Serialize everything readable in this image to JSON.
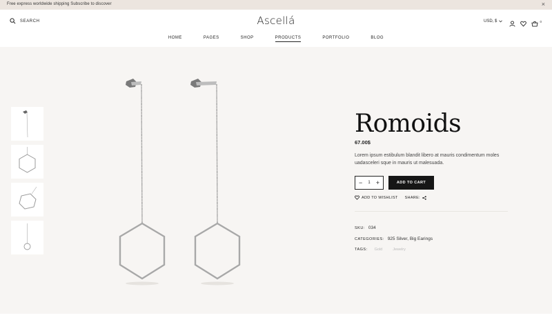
{
  "announcement": {
    "text": "Free express worldwide shipping Subscribe to discover",
    "close": "×"
  },
  "header": {
    "search_label": "SEARCH",
    "logo": "Ascellá",
    "currency": "USD, $",
    "cart_count": "0"
  },
  "nav": {
    "items": [
      "HOME",
      "PAGES",
      "SHOP",
      "PRODUCTS",
      "PORTFOLIO",
      "BLOG"
    ],
    "active": "PRODUCTS"
  },
  "product": {
    "title": "Romoids",
    "price": "67.00$",
    "description": "Lorem ipsum estibulum blandit libero at mauris condimentum moles uadasceleri sque in mauris ut malesuada.",
    "quantity": "1",
    "minus": "−",
    "plus": "+",
    "add_to_cart": "ADD TO CART",
    "wishlist": "ADD TO WISHLIST",
    "share": "SHARE:",
    "sku_label": "SKU:",
    "sku": "034",
    "categories_label": "CATEGORIES:",
    "categories": "925 Silver, Big Earings",
    "tags_label": "TAGS:",
    "tags": [
      "Gold",
      "Jewelry"
    ]
  },
  "colors": {
    "announcement_bg": "#ece5df",
    "page_bg": "#f7f5f3",
    "button_bg": "#161616",
    "silver": "#9a9a9a"
  },
  "icons": [
    "search-icon",
    "chevron-down-icon",
    "user-icon",
    "heart-icon",
    "cart-icon",
    "close-icon",
    "share-icon"
  ]
}
